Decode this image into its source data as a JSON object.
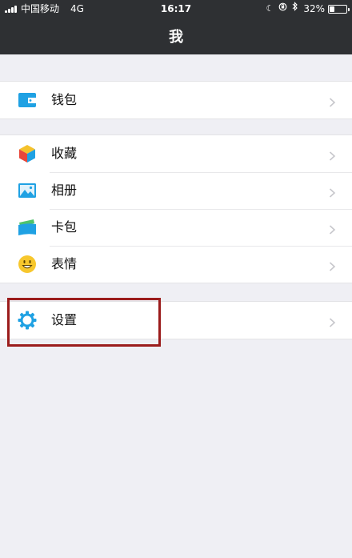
{
  "status_bar": {
    "carrier": "中国移动",
    "network": "4G",
    "time": "16:17",
    "battery": "32%",
    "battery_level": 0.32
  },
  "nav": {
    "title": "我"
  },
  "menu": {
    "wallet": {
      "label": "钱包",
      "icon": "wallet-icon"
    },
    "favorites": {
      "label": "收藏",
      "icon": "cube-icon"
    },
    "album": {
      "label": "相册",
      "icon": "photo-icon"
    },
    "cards": {
      "label": "卡包",
      "icon": "card-holder-icon"
    },
    "stickers": {
      "label": "表情",
      "icon": "smiley-icon"
    },
    "settings": {
      "label": "设置",
      "icon": "gear-icon"
    }
  },
  "colors": {
    "topbar": "#2e3033",
    "background": "#efeff4",
    "icon_blue": "#1fa1e3",
    "highlight": "#9b1c1c"
  }
}
